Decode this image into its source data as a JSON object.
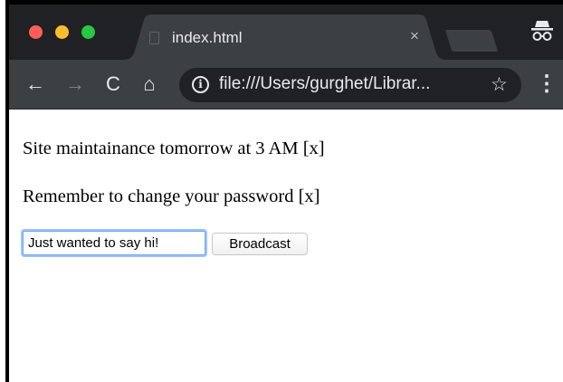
{
  "tab": {
    "title": "index.html",
    "close_glyph": "×"
  },
  "toolbar": {
    "back_glyph": "←",
    "forward_glyph": "→",
    "reload_glyph": "C",
    "home_glyph": "⌂",
    "url": "file:///Users/gurghet/Librar...",
    "info_glyph": "i",
    "star_glyph": "☆",
    "menu_glyph": "⋮"
  },
  "page": {
    "messages": [
      "Site maintainance tomorrow at 3 AM [x]",
      "Remember to change your password [x]"
    ],
    "input_value": "Just wanted to say hi!",
    "button_label": "Broadcast"
  },
  "colors": {
    "tabstrip": "#202124",
    "toolbar": "#3c4043",
    "close": "#ff5f57",
    "minimize": "#febc2e",
    "zoom": "#28c840",
    "focus_ring": "#9cc3fb"
  },
  "icons": [
    "close-window-icon",
    "minimize-window-icon",
    "zoom-window-icon",
    "file-icon",
    "incognito-icon",
    "info-icon",
    "star-icon",
    "menu-icon",
    "back-icon",
    "forward-icon",
    "reload-icon",
    "home-icon"
  ]
}
